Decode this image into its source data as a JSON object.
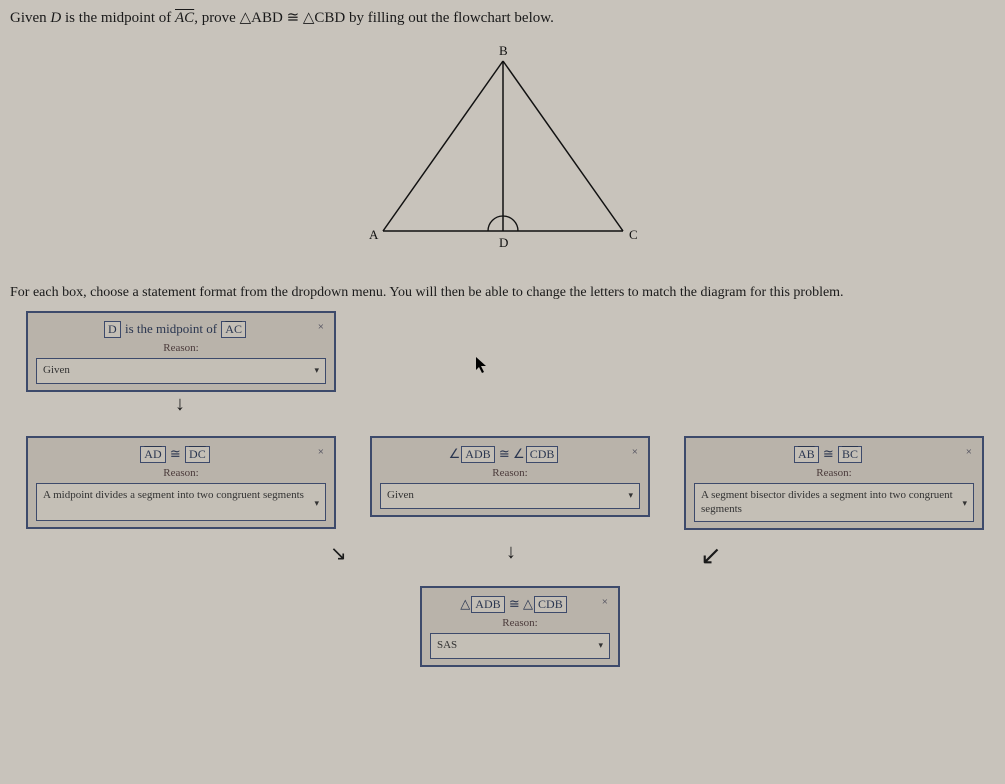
{
  "problem": {
    "prefix": "Given ",
    "D": "D",
    "mid_text": " is the midpoint of ",
    "AC": "AC",
    "prove_text": ", prove ",
    "tri1": "△ABD",
    "cong": " ≅ ",
    "tri2": "△CBD",
    "suffix": " by filling out the flowchart below."
  },
  "diagram": {
    "A": "A",
    "B": "B",
    "C": "C",
    "D": "D"
  },
  "instructions": "For each box, choose a statement format from the dropdown menu. You will then be able to change the letters to match the diagram for this problem.",
  "cards": {
    "c1": {
      "val1": "D",
      "mid": " is the midpoint of ",
      "val2": "AC",
      "reason_label": "Reason:",
      "reason_value": "Given"
    },
    "c2": {
      "val1": "AD",
      "cong": " ≅ ",
      "val2": "DC",
      "reason_label": "Reason:",
      "reason_value": "A midpoint divides a segment into two congruent segments"
    },
    "c3": {
      "ang": "∠",
      "val1": "ADB",
      "cong": " ≅ ",
      "val2": "CDB",
      "reason_label": "Reason:",
      "reason_value": "Given"
    },
    "c4": {
      "val1": "AB",
      "cong": " ≅ ",
      "val2": "BC",
      "reason_label": "Reason:",
      "reason_value": "A segment bisector divides a segment into two congruent segments"
    },
    "c5": {
      "tri": "△",
      "val1": "ADB",
      "cong": " ≅ ",
      "val2": "CDB",
      "reason_label": "Reason:",
      "reason_value": "SAS"
    }
  },
  "close": "×"
}
